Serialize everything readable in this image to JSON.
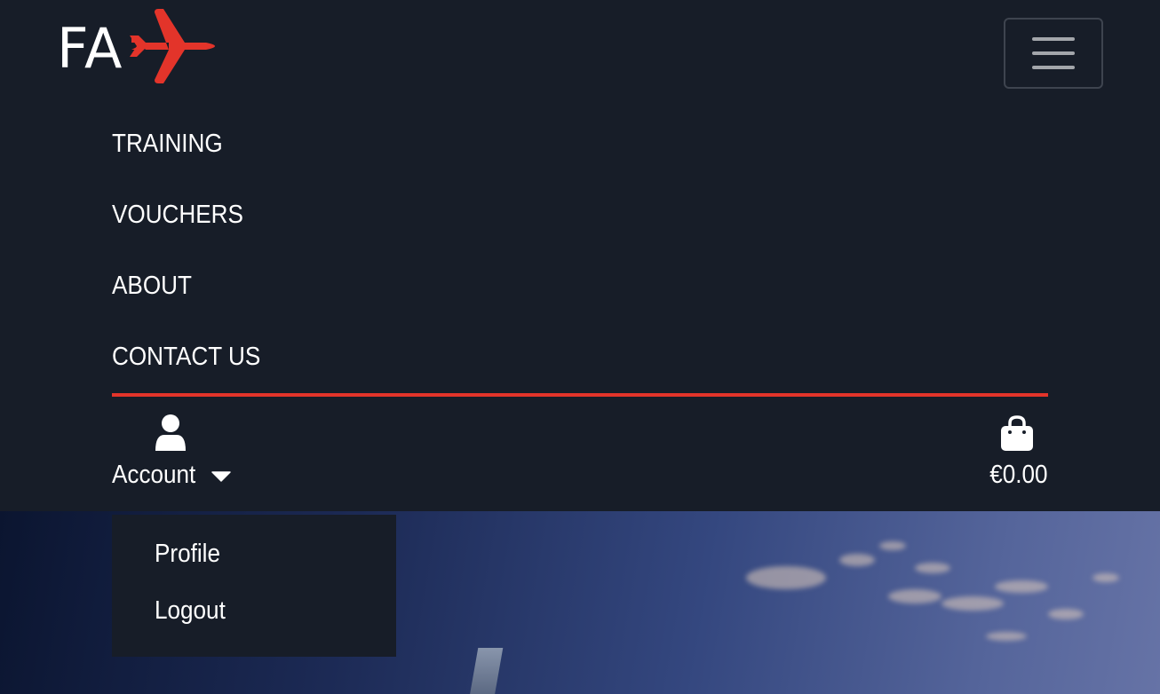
{
  "brand": {
    "logo_text": "FA",
    "logo_icon": "airplane-icon",
    "accent_color": "#e3342a"
  },
  "navbar": {
    "toggler_icon": "hamburger-icon",
    "links": [
      {
        "label": "TRAINING"
      },
      {
        "label": "VOUCHERS"
      },
      {
        "label": "ABOUT"
      },
      {
        "label": "CONTACT US"
      }
    ]
  },
  "account": {
    "icon": "user-icon",
    "label": "Account",
    "caret_icon": "caret-down-icon"
  },
  "bag": {
    "icon": "shopping-bag-icon",
    "total": "€0.00"
  },
  "account_menu": {
    "items": [
      {
        "label": "Profile"
      },
      {
        "label": "Logout"
      }
    ]
  },
  "colors": {
    "navbar_bg": "#171d28",
    "text": "#ffffff",
    "divider": "#e3342a"
  }
}
